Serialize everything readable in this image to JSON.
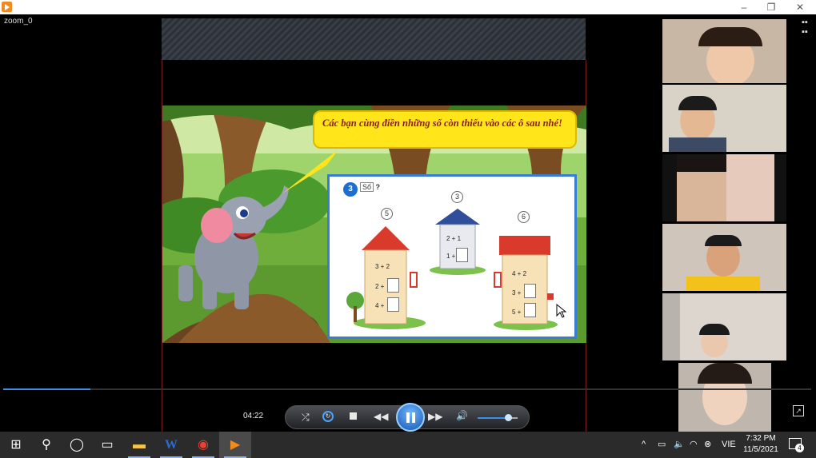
{
  "window": {
    "filename": "zoom_0",
    "minimize": "–",
    "maximize": "❐",
    "close": "✕"
  },
  "slide": {
    "bubble_text": "Các bạn cùng điền những số còn thiếu vào các ô sau nhé!",
    "exercise": {
      "number": "3",
      "label": "Số",
      "question_mark": "?",
      "houses": [
        {
          "result": "5",
          "ops": [
            "3 + 2",
            "2 +",
            "4 +"
          ]
        },
        {
          "result": "3",
          "ops": [
            "2 + 1",
            "1 +"
          ]
        },
        {
          "result": "6",
          "ops": [
            "4 + 2",
            "3 +",
            "5 +"
          ]
        }
      ]
    }
  },
  "player": {
    "time": "04:22",
    "progress": 0.108,
    "volume": 0.75,
    "accent": "#3a8ee6"
  },
  "taskbar": {
    "language": "VIE",
    "time": "7:32 PM",
    "date": "11/5/2021",
    "notifications": "4"
  }
}
